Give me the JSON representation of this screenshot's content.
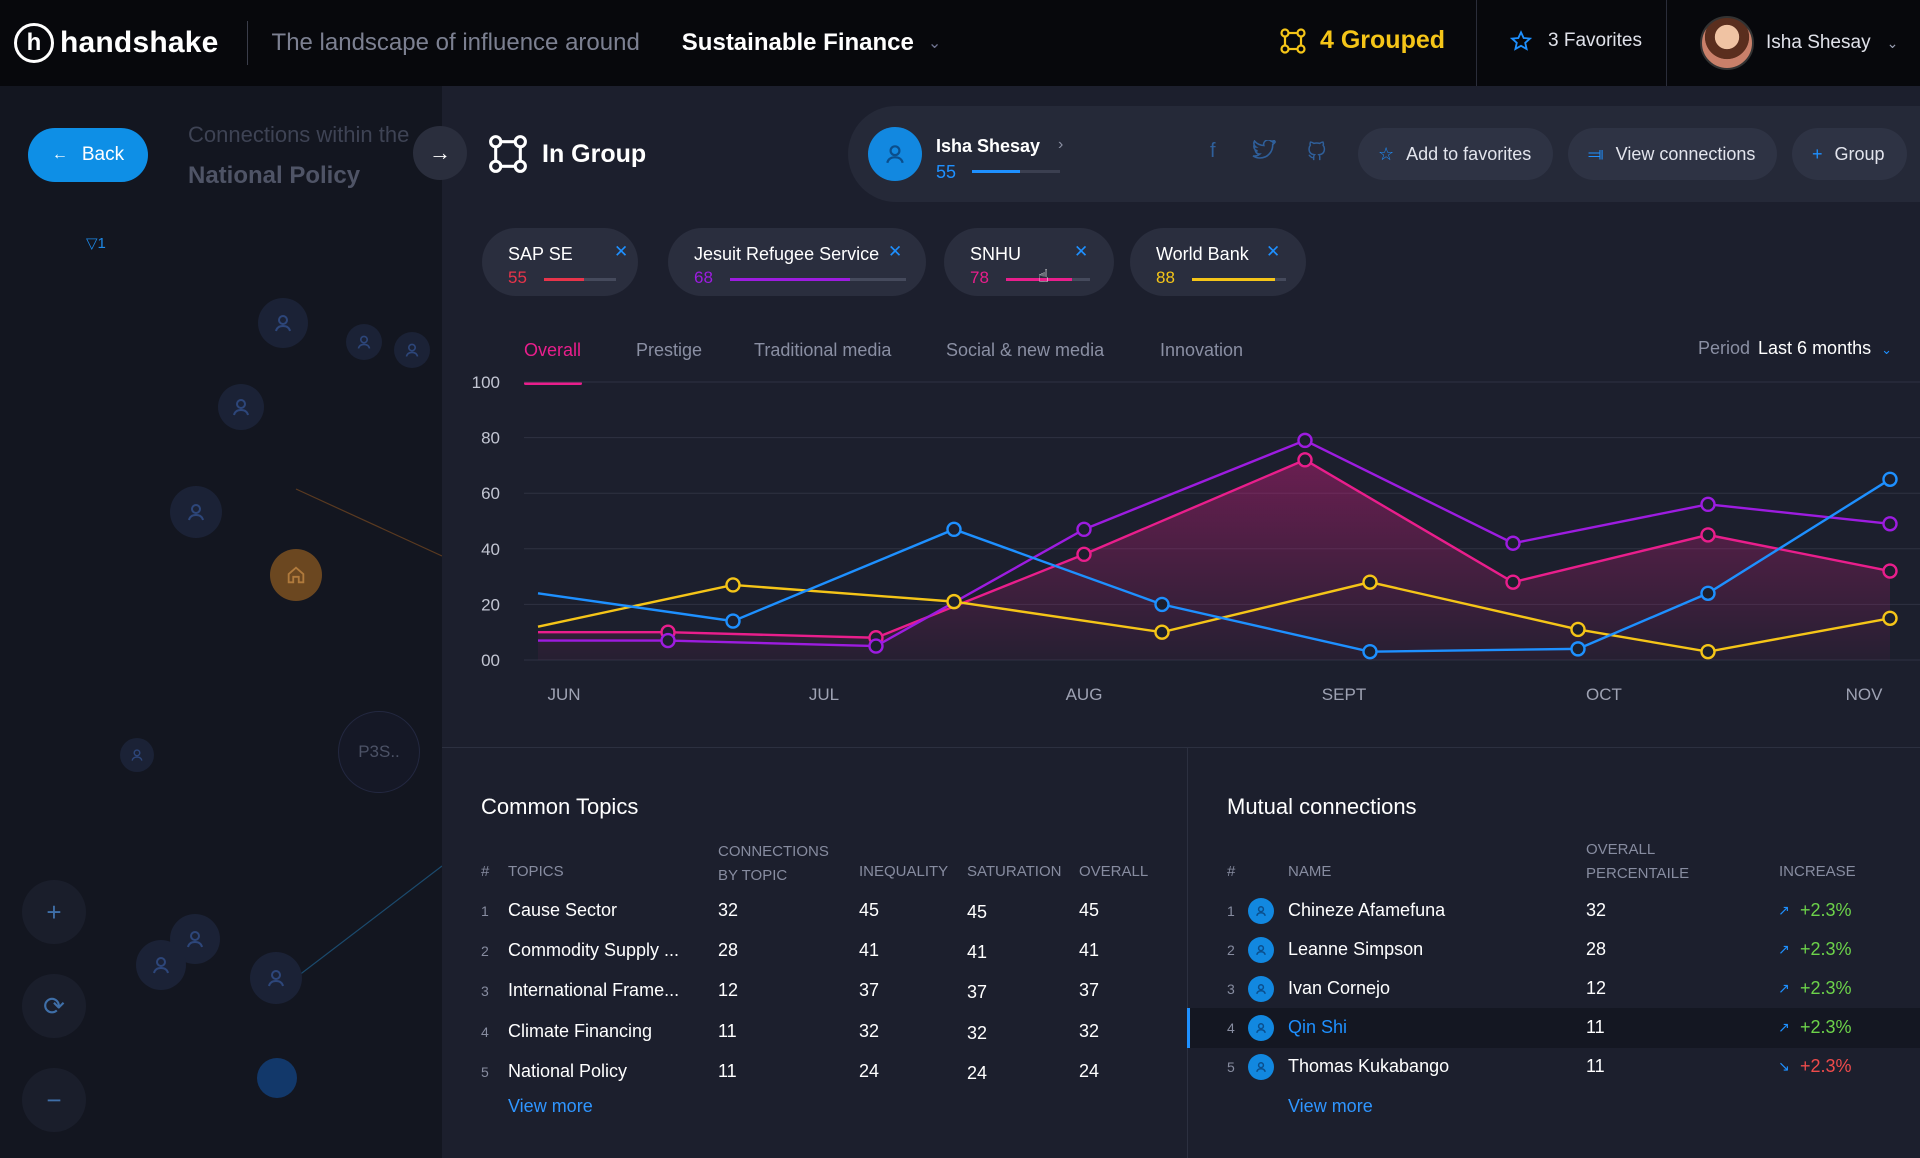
{
  "app": {
    "brand": "handshake",
    "tagline": "The landscape of influence around",
    "topic": "Sustainable Finance",
    "grouped_label": "4 Grouped",
    "favorites_label": "3 Favorites",
    "user_name": "Isha Shesay"
  },
  "left": {
    "back_label": "Back",
    "connections_label": "Connections within the",
    "connections_value": "National Policy",
    "filter_count": "1",
    "node_label": "P3S.."
  },
  "group": {
    "title": "In Group"
  },
  "profile": {
    "name": "Isha Shesay",
    "score": "55",
    "score_fraction": 0.55,
    "add_favorites": "Add to favorites",
    "view_connections": "View connections",
    "group": "Group"
  },
  "chips": [
    {
      "label": "SAP SE",
      "score": "55",
      "fraction": 0.55,
      "color": "#e8344a"
    },
    {
      "label": "Jesuit Refugee Service",
      "score": "68",
      "fraction": 0.68,
      "color": "#9d1ce0"
    },
    {
      "label": "SNHU",
      "score": "78",
      "fraction": 0.78,
      "color": "#e91e8c"
    },
    {
      "label": "World Bank",
      "score": "88",
      "fraction": 0.88,
      "color": "#f5c518"
    }
  ],
  "tabs": [
    "Overall",
    "Prestige",
    "Traditional media",
    "Social & new media",
    "Innovation"
  ],
  "period": {
    "label": "Period",
    "value": "Last 6 months"
  },
  "chart_data": {
    "type": "line",
    "x": [
      "JUN",
      "JUL",
      "AUG",
      "SEPT",
      "OCT",
      "NOV"
    ],
    "y_ticks": [
      "100",
      "80",
      "60",
      "40",
      "20",
      "00"
    ],
    "ylim": [
      0,
      100
    ],
    "series": [
      {
        "color": "#1e90ff",
        "points": [
          [
            -0.1,
            24
          ],
          [
            0.65,
            14
          ],
          [
            1.5,
            47
          ],
          [
            2.3,
            20
          ],
          [
            3.1,
            3
          ],
          [
            3.9,
            4
          ],
          [
            4.4,
            24
          ],
          [
            5.1,
            65
          ]
        ]
      },
      {
        "color": "#f5c518",
        "points": [
          [
            -0.1,
            12
          ],
          [
            0.65,
            27
          ],
          [
            1.5,
            21
          ],
          [
            2.3,
            10
          ],
          [
            3.1,
            28
          ],
          [
            3.9,
            11
          ],
          [
            4.4,
            3
          ],
          [
            5.1,
            15
          ]
        ]
      },
      {
        "color": "#9d1ce0",
        "points": [
          [
            -0.1,
            7
          ],
          [
            0.4,
            7
          ],
          [
            1.2,
            5
          ],
          [
            2.0,
            47
          ],
          [
            2.85,
            79
          ],
          [
            3.65,
            42
          ],
          [
            4.4,
            56
          ],
          [
            5.1,
            49
          ]
        ]
      },
      {
        "color": "#e91e8c",
        "fill": true,
        "points": [
          [
            -0.1,
            10
          ],
          [
            0.4,
            10
          ],
          [
            1.2,
            8
          ],
          [
            2.0,
            38
          ],
          [
            2.85,
            72
          ],
          [
            3.65,
            28
          ],
          [
            4.4,
            45
          ],
          [
            5.1,
            32
          ]
        ]
      }
    ]
  },
  "topics": {
    "title": "Common Topics",
    "headers": {
      "num": "#",
      "topics": "TOPICS",
      "connections": "CONNECTIONS BY TOPIC",
      "inequality": "INEQUALITY",
      "saturation": "SATURATION",
      "overall": "OVERALL"
    },
    "rows": [
      {
        "n": "1",
        "topic": "Cause Sector",
        "connections": "32",
        "inequality": "45",
        "saturation": "45",
        "overall": "45"
      },
      {
        "n": "2",
        "topic": "Commodity Supply ...",
        "connections": "28",
        "inequality": "41",
        "saturation": "41",
        "overall": "41"
      },
      {
        "n": "3",
        "topic": "International Frame...",
        "connections": "12",
        "inequality": "37",
        "saturation": "37",
        "overall": "37"
      },
      {
        "n": "4",
        "topic": "Climate Financing",
        "connections": "11",
        "inequality": "32",
        "saturation": "32",
        "overall": "32"
      },
      {
        "n": "5",
        "topic": "National Policy",
        "connections": "11",
        "inequality": "24",
        "saturation": "24",
        "overall": "24"
      }
    ],
    "view_more": "View more"
  },
  "mutual": {
    "title": "Mutual connections",
    "headers": {
      "num": "#",
      "name": "NAME",
      "percentile": "OVERALL PERCENTAILE",
      "increase": "INCREASE"
    },
    "rows": [
      {
        "n": "1",
        "name": "Chineze Afamefuna",
        "percentile": "32",
        "increase": "+2.3%",
        "trend": "up"
      },
      {
        "n": "2",
        "name": "Leanne Simpson",
        "percentile": "28",
        "increase": "+2.3%",
        "trend": "up"
      },
      {
        "n": "3",
        "name": "Ivan Cornejo",
        "percentile": "12",
        "increase": "+2.3%",
        "trend": "up"
      },
      {
        "n": "4",
        "name": "Qin Shi",
        "percentile": "11",
        "increase": "+2.3%",
        "trend": "up",
        "selected": true
      },
      {
        "n": "5",
        "name": "Thomas Kukabango",
        "percentile": "11",
        "increase": "+2.3%",
        "trend": "down"
      }
    ],
    "view_more": "View more"
  }
}
